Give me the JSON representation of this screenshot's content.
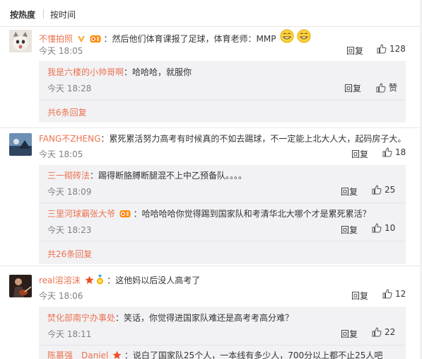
{
  "sort": {
    "hot": "按热度",
    "time": "按时间"
  },
  "comments": [
    {
      "user": "不懂拍照",
      "text": "：然后他们体育课报了足球，体育老师：MMP",
      "time": "今天 18:05",
      "reply": "回复",
      "likes": "128",
      "subs": [
        {
          "user": "我是六楼的小帅哥啊",
          "text": "：哈哈哈，就服你",
          "time": "今天 18:28",
          "reply": "回复",
          "likes": "赞"
        }
      ],
      "more": "共6条回复"
    },
    {
      "user": "FANG不ZHENG",
      "text": "：累死累活努力高考有时候真的不如去踢球，不一定能上北大人大，起码房子大。",
      "time": "今天 18:05",
      "reply": "回复",
      "likes": "18",
      "subs": [
        {
          "user": "三一砌砖法",
          "text": "：踢得断胳膊断腿混不上中乙预备队。。。。",
          "time": "今天 18:09",
          "reply": "回复",
          "likes": "25"
        },
        {
          "user": "三里河球霸张大爷",
          "text": "：哈哈哈哈你觉得踢到国家队和考清华北大哪个才是累死累活？",
          "time": "今天 18:23",
          "reply": "回复",
          "likes": "10"
        }
      ],
      "more": "共26条回复"
    },
    {
      "user": "real溶溶沫",
      "text": "：这他妈以后没人高考了",
      "time": "今天 18:06",
      "reply": "回复",
      "likes": "12",
      "subs": [
        {
          "user": "焚化部南宁办事处",
          "text": "：笑话，你觉得进国家队难还是高考考高分难？",
          "time": "今天 18:11",
          "reply": "回复",
          "likes": "22"
        },
        {
          "user": "陈慕强＿Daniel",
          "text": "：说白了国家队25个人，一本线有多少人，700分以上都不止25人吧",
          "time": "",
          "reply": "",
          "likes": ""
        }
      ],
      "more": ""
    }
  ],
  "colors": {
    "accent": "#eb7350",
    "sub_bg": "#f2f2f5",
    "muted": "#808080"
  }
}
